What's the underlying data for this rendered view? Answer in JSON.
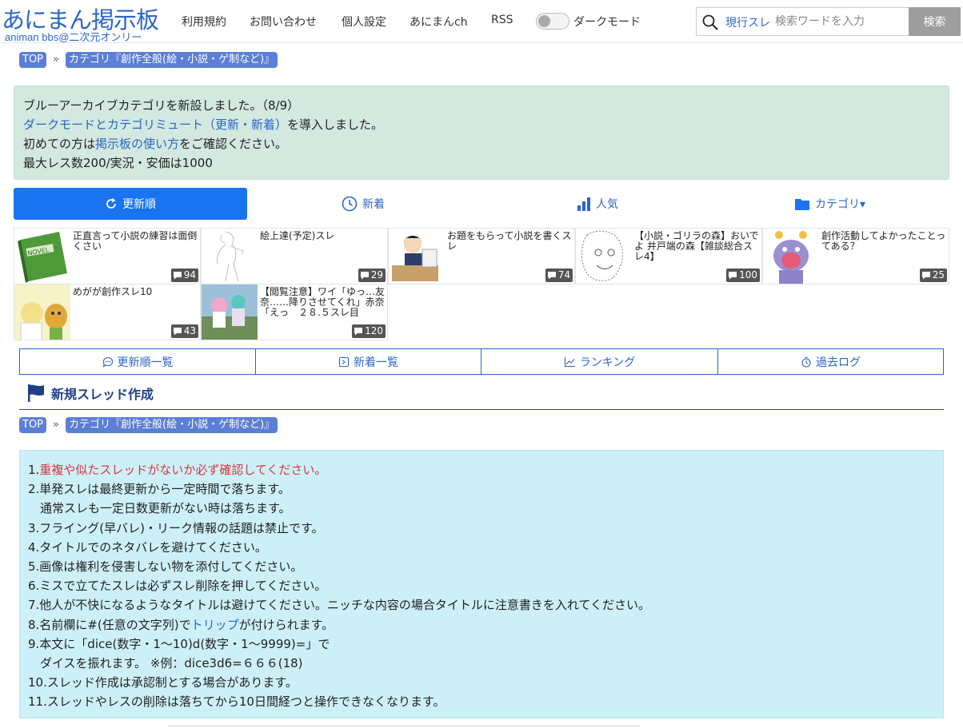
{
  "header": {
    "logo_main": "あにまん掲示板",
    "logo_sub": "animan bbs@二次元オンリー",
    "nav": [
      "利用規約",
      "お問い合わせ",
      "個人設定",
      "あにまんch",
      "RSS"
    ],
    "dark_mode_label": "ダークモード",
    "search_scope": "現行スレ",
    "search_placeholder": "検索ワードを入力",
    "search_button": "検索"
  },
  "breadcrumb": {
    "top": "TOP",
    "sep": "»",
    "category": "カテゴリ『創作全般(絵・小説・ゲ制など)』"
  },
  "notice": {
    "line1": "ブルーアーカイブカテゴリを新設しました。（8/9）",
    "line2_link": "ダークモードとカテゴリミュート（更新・新着）",
    "line2_rest": "を導入しました。",
    "line3_pre": "初めての方は",
    "line3_link": "掲示板の使い方",
    "line3_post": "をご確認ください。",
    "line4": "最大レス数200/実況・安価は1000"
  },
  "tabs": [
    {
      "label": "更新順",
      "icon": "refresh-icon",
      "active": true
    },
    {
      "label": "新着",
      "icon": "clock-icon",
      "active": false
    },
    {
      "label": "人気",
      "icon": "bar-chart-icon",
      "active": false
    },
    {
      "label": "カテゴリ▾",
      "icon": "folder-icon",
      "active": false
    }
  ],
  "threads": [
    {
      "title": "正直言って小説の練習は面倒くさい",
      "count": "94",
      "thumb_label": "NOVEL"
    },
    {
      "title": "絵上達(予定)スレ",
      "count": "29"
    },
    {
      "title": "お題をもらって小説を書くスレ",
      "count": "74"
    },
    {
      "title": "【小説・ゴリラの森】おいでよ 井戸端の森【雑談総合スレ4】",
      "count": "100"
    },
    {
      "title": "創作活動してよかったことってある？",
      "count": "25"
    },
    {
      "title": "めがが創作スレ10",
      "count": "43"
    },
    {
      "title": "【閲覧注意】ワイ「ゆっ…友奈……降りさせてくれ」赤奈「えっ　２８.５スレ目",
      "count": "120"
    }
  ],
  "subnav": [
    {
      "label": "更新順一覧",
      "icon": "chat-icon"
    },
    {
      "label": "新着一覧",
      "icon": "new-icon"
    },
    {
      "label": "ランキング",
      "icon": "trend-icon"
    },
    {
      "label": "過去ログ",
      "icon": "timer-icon"
    }
  ],
  "section_title": "新規スレッド作成",
  "rules": {
    "r1_num": "1.",
    "r1": "重複や似たスレッドがないか必ず確認してください。",
    "r2": "2.単発スレは最終更新から一定時間で落ちます。",
    "r2b": "　通常スレも一定日数更新がない時は落ちます。",
    "r3": "3.フライング(早バレ)・リーク情報の話題は禁止です。",
    "r4": "4.タイトルでのネタバレを避けてください。",
    "r5": "5.画像は権利を侵害しない物を添付してください。",
    "r6": "6.ミスで立てたスレは必ずスレ削除を押してください。",
    "r7": "7.他人が不快になるようなタイトルは避けてください。ニッチな内容の場合タイトルに注意書きを入れてください。",
    "r8_pre": "8.名前欄に#(任意の文字列)で",
    "r8_link": "トリップ",
    "r8_post": "が付けられます。",
    "r9": "9.本文に「dice(数字・1～10)d(数字・1～9999)=」で",
    "r9b": "　ダイスを振れます。 ※例：dice3d6=６６６(18)",
    "r10": "10.スレッド作成は承認制とする場合があります。",
    "r11": "11.スレッドやレスの削除は落ちてから10日間経つと操作できなくなります。"
  },
  "colors": {
    "brand": "#2a66c9",
    "active_tab": "#1a74f0",
    "pill": "#5b7fd6",
    "notice_bg": "#d3e8df",
    "rules_bg": "#cdf0f8",
    "warning": "#d9363e"
  }
}
